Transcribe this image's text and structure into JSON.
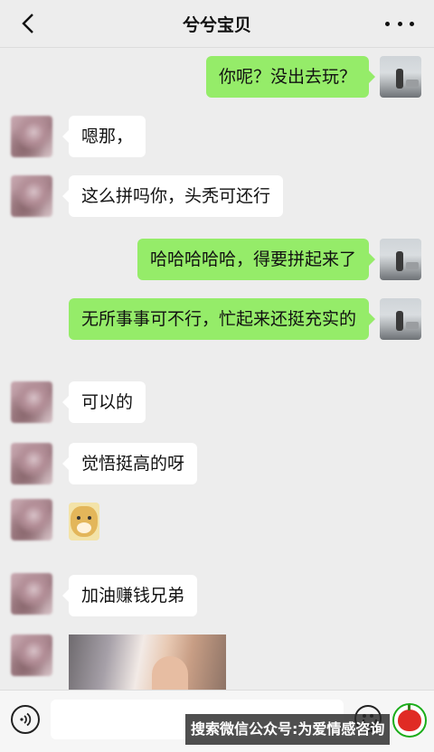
{
  "header": {
    "title": "兮兮宝贝"
  },
  "messages": [
    {
      "side": "right",
      "type": "text",
      "text": "你呢？没出去玩？"
    },
    {
      "side": "left",
      "type": "text",
      "text": "嗯那，"
    },
    {
      "side": "left",
      "type": "text",
      "text": "这么拼吗你，头秃可还行"
    },
    {
      "side": "right",
      "type": "text",
      "text": "哈哈哈哈哈，得要拼起来了"
    },
    {
      "side": "right",
      "type": "text",
      "text": "无所事事可不行，忙起来还挺充实的"
    },
    {
      "side": "left",
      "type": "text",
      "text": "可以的"
    },
    {
      "side": "left",
      "type": "text",
      "text": "觉悟挺高的呀"
    },
    {
      "side": "left",
      "type": "sticker",
      "icon": "doge-sticker"
    },
    {
      "side": "left",
      "type": "text",
      "text": "加油赚钱兄弟"
    },
    {
      "side": "left",
      "type": "image",
      "icon": "photo-hand"
    }
  ],
  "input": {
    "value": "",
    "placeholder": ""
  },
  "watermark": {
    "text": "搜索微信公众号:为爱情感咨询"
  },
  "colors": {
    "background": "#ededed",
    "bubble_self": "#95ec69",
    "bubble_other": "#ffffff"
  }
}
